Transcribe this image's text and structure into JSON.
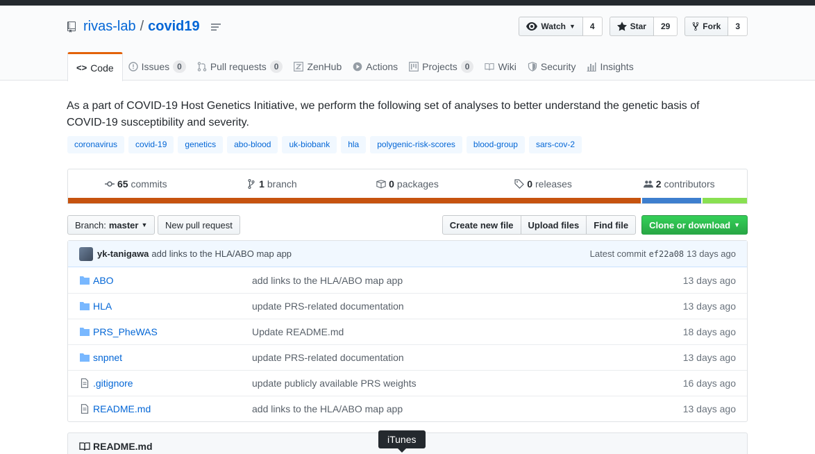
{
  "repo": {
    "owner": "rivas-lab",
    "separator": "/",
    "name": "covid19"
  },
  "actions": {
    "watch": {
      "label": "Watch",
      "count": "4"
    },
    "star": {
      "label": "Star",
      "count": "29"
    },
    "fork": {
      "label": "Fork",
      "count": "3"
    }
  },
  "tabs": [
    {
      "label": "Code",
      "count": null
    },
    {
      "label": "Issues",
      "count": "0"
    },
    {
      "label": "Pull requests",
      "count": "0"
    },
    {
      "label": "ZenHub",
      "count": null
    },
    {
      "label": "Actions",
      "count": null
    },
    {
      "label": "Projects",
      "count": "0"
    },
    {
      "label": "Wiki",
      "count": null
    },
    {
      "label": "Security",
      "count": null
    },
    {
      "label": "Insights",
      "count": null
    }
  ],
  "description": "As a part of COVID-19 Host Genetics Initiative, we perform the following set of analyses to better understand the genetic basis of COVID-19 susceptibility and severity.",
  "topics": [
    "coronavirus",
    "covid-19",
    "genetics",
    "abo-blood",
    "uk-biobank",
    "hla",
    "polygenic-risk-scores",
    "blood-group",
    "sars-cov-2"
  ],
  "summary": {
    "commits": {
      "num": "65",
      "label": "commits"
    },
    "branches": {
      "num": "1",
      "label": "branch"
    },
    "packages": {
      "num": "0",
      "label": "packages"
    },
    "releases": {
      "num": "0",
      "label": "releases"
    },
    "contributors": {
      "num": "2",
      "label": "contributors"
    }
  },
  "languages": [
    {
      "color": "#c6530f",
      "fraction": 0.847
    },
    {
      "color": "#3e7fce",
      "fraction": 0.087
    },
    {
      "color": "#89e051",
      "fraction": 0.066
    }
  ],
  "filebar": {
    "branch_prefix": "Branch:",
    "branch_name": "master",
    "new_pr": "New pull request",
    "create_file": "Create new file",
    "upload_files": "Upload files",
    "find_file": "Find file",
    "clone": "Clone or download"
  },
  "latest_commit": {
    "author": "yk-tanigawa",
    "message": "add links to the HLA/ABO map app",
    "label": "Latest commit",
    "sha": "ef22a08",
    "age": "13 days ago"
  },
  "files": [
    {
      "type": "dir",
      "name": "ABO",
      "message": "add links to the HLA/ABO map app",
      "age": "13 days ago"
    },
    {
      "type": "dir",
      "name": "HLA",
      "message": "update PRS-related documentation",
      "age": "13 days ago"
    },
    {
      "type": "dir",
      "name": "PRS_PheWAS",
      "message": "Update README.md",
      "age": "18 days ago"
    },
    {
      "type": "dir",
      "name": "snpnet",
      "message": "update PRS-related documentation",
      "age": "13 days ago"
    },
    {
      "type": "file",
      "name": ".gitignore",
      "message": "update publicly available PRS weights",
      "age": "16 days ago"
    },
    {
      "type": "file",
      "name": "README.md",
      "message": "add links to the HLA/ABO map app",
      "age": "13 days ago"
    }
  ],
  "readme": {
    "title": "README.md"
  },
  "tooltip": {
    "text": "iTunes"
  },
  "icons": {
    "book": "repo-book-icon",
    "watch": "eye-icon",
    "star": "star-icon",
    "fork": "fork-icon",
    "folder": "folder-icon",
    "file": "file-icon"
  }
}
